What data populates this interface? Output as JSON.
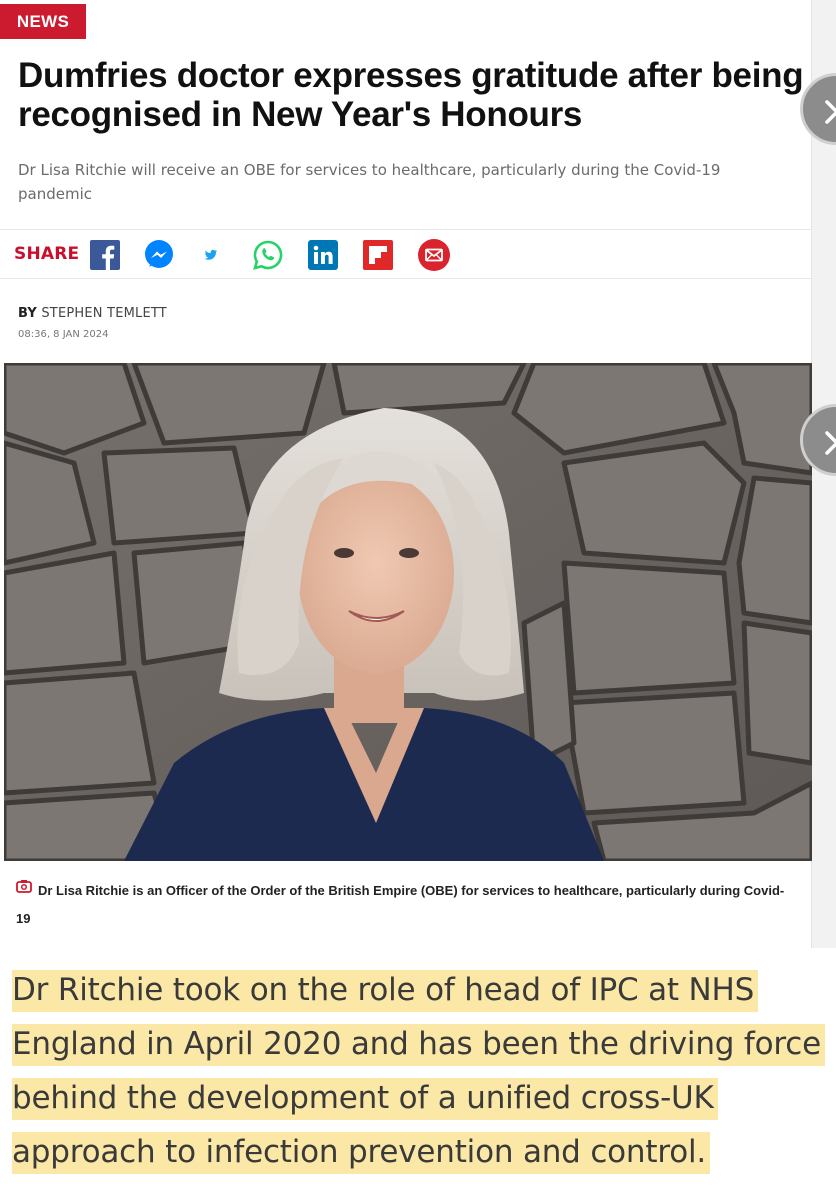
{
  "category_badge": "NEWS",
  "headline": "Dumfries doctor expresses gratitude after being recognised in New Year's Honours",
  "standfirst": "Dr Lisa Ritchie will receive an OBE for services to healthcare, particularly during the Covid-19 pandemic",
  "share": {
    "label": "SHARE",
    "icons": [
      "facebook-icon",
      "messenger-icon",
      "twitter-icon",
      "whatsapp-icon",
      "linkedin-icon",
      "flipboard-icon",
      "email-icon"
    ],
    "colors": {
      "facebook": "#3b5998",
      "messenger": "#0084ff",
      "twitter": "#1da1f2",
      "whatsapp": "#25d366",
      "linkedin": "#0077b5",
      "flipboard": "#e12828",
      "email": "#d9232d"
    }
  },
  "byline": {
    "prefix": "BY",
    "author": "STEPHEN TEMLETT"
  },
  "dateline": "08:36, 8 JAN 2024",
  "photo": {
    "caption": "Dr Lisa Ritchie is an Officer of the Order of the British Empire (OBE) for services to healthcare, particularly during Covid-19"
  },
  "quote": "Dr Ritchie took on the role of head of IPC at NHS England in April 2020 and has been the driving force behind the development of a unified cross-UK approach to infection prevention and control.",
  "colors": {
    "accent": "#cc1a2e",
    "highlight": "#fbe8a6"
  }
}
